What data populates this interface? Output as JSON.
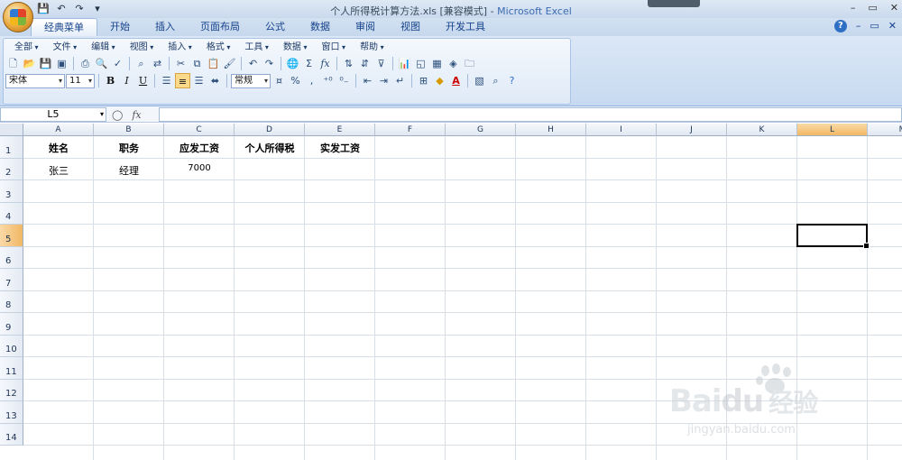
{
  "window": {
    "title": "个人所得税计算方法.xls",
    "mode": "[兼容模式]",
    "app": "Microsoft Excel",
    "controls": [
      "–",
      "▭",
      "✕"
    ]
  },
  "ribbon_tabs": [
    "经典菜单",
    "开始",
    "插入",
    "页面布局",
    "公式",
    "数据",
    "审阅",
    "视图",
    "开发工具"
  ],
  "active_tab": "经典菜单",
  "help_buttons": [
    "?",
    "–",
    "▭",
    "✕"
  ],
  "classic_menu": [
    "全部",
    "文件",
    "编辑",
    "视图",
    "插入",
    "格式",
    "工具",
    "数据",
    "窗口",
    "帮助"
  ],
  "toolbar": {
    "font_name": "宋体",
    "font_size": "11",
    "number_format": "常规",
    "bold": "B",
    "italic": "I",
    "underline": "U",
    "percent": "%",
    "comma": ",",
    "sum": "Σ",
    "fx": "fx",
    "font_color_letter": "A"
  },
  "formula_bar": {
    "name_box": "L5",
    "fx_label": "fx",
    "value": ""
  },
  "columns": [
    "A",
    "B",
    "C",
    "D",
    "E",
    "F",
    "G",
    "H",
    "I",
    "J",
    "K",
    "L",
    "M"
  ],
  "selected_column": "L",
  "rows": [
    "1",
    "2",
    "3",
    "4",
    "5",
    "6",
    "7",
    "8",
    "9",
    "10",
    "11",
    "12",
    "13",
    "14"
  ],
  "selected_row": "5",
  "cells": {
    "A1": "姓名",
    "B1": "职务",
    "C1": "应发工资",
    "D1": "个人所得税",
    "E1": "实发工资",
    "A2": "张三",
    "B2": "经理",
    "C2": "7000"
  },
  "watermark": {
    "brand_a": "Bai",
    "brand_b": "du",
    "brand_c": "经验",
    "sub": "jingyan.baidu.com"
  }
}
